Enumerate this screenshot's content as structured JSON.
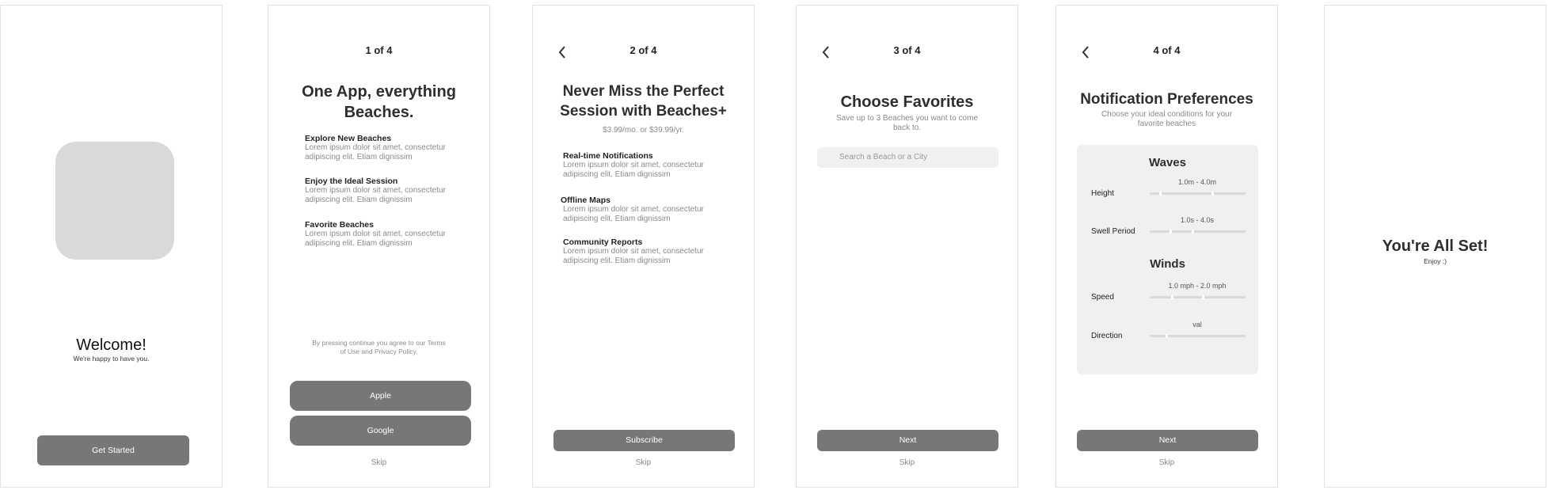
{
  "s1": {
    "title": "Welcome!",
    "subtitle": "We're happy to have you.",
    "button": "Get Started"
  },
  "s2": {
    "step": "1 of 4",
    "title_line1": "One App, everything",
    "title_line2": "Beaches.",
    "features": [
      {
        "title": "Explore New Beaches",
        "body": "Lorem ipsum dolor sit amet, consectetur adipiscing elit. Etiam dignissim"
      },
      {
        "title": "Enjoy the Ideal Session",
        "body": "Lorem ipsum dolor sit amet, consectetur adipiscing elit. Etiam dignissim"
      },
      {
        "title": "Favorite Beaches",
        "body": "Lorem ipsum dolor sit amet, consectetur adipiscing elit. Etiam dignissim"
      }
    ],
    "terms_line1": "By pressing continue you agree to our Terms",
    "terms_line2": "of Use and Privacy Policy.",
    "apple": "Apple",
    "google": "Google",
    "skip": "Skip"
  },
  "s3": {
    "step": "2 of 4",
    "title_line1": "Never Miss the Perfect",
    "title_line2": "Session with Beaches+",
    "price": "$3.99/mo. or $39.99/yr.",
    "features": [
      {
        "title": "Real-time Notifications",
        "body": "Lorem ipsum dolor sit amet, consectetur adipiscing elit. Etiam dignissim"
      },
      {
        "title": "Offline Maps",
        "body": "Lorem ipsum dolor sit amet, consectetur adipiscing elit. Etiam dignissim"
      },
      {
        "title": "Community Reports",
        "body": "Lorem ipsum dolor sit amet, consectetur adipiscing elit. Etiam dignissim"
      }
    ],
    "button": "Subscribe",
    "skip": "Skip"
  },
  "s4": {
    "step": "3 of 4",
    "title": "Choose Favorites",
    "subtitle_line1": "Save up to 3 Beaches you want to come",
    "subtitle_line2": "back to.",
    "search_placeholder": "Search a Beach or a City",
    "button": "Next",
    "skip": "Skip"
  },
  "s5": {
    "step": "4 of 4",
    "title": "Notification Preferences",
    "subtitle_line1": "Choose your ideal conditions for your",
    "subtitle_line2": "favorite beaches",
    "waves": "Waves",
    "height_label": "Height",
    "height_range": "1.0m - 4.0m",
    "swell_label": "Swell Period",
    "swell_range": "1.0s - 4.0s",
    "winds": "Winds",
    "speed_label": "Speed",
    "speed_range": "1.0 mph - 2.0 mph",
    "direction_label": "Direction",
    "direction_value": "val",
    "button": "Next",
    "skip": "Skip"
  },
  "s6": {
    "title": "You're All Set!",
    "subtitle": "Enjoy :)"
  },
  "colors": {
    "button": "#777777",
    "panel": "#f0f0f0",
    "placeholder_image": "#d9d9d9"
  }
}
